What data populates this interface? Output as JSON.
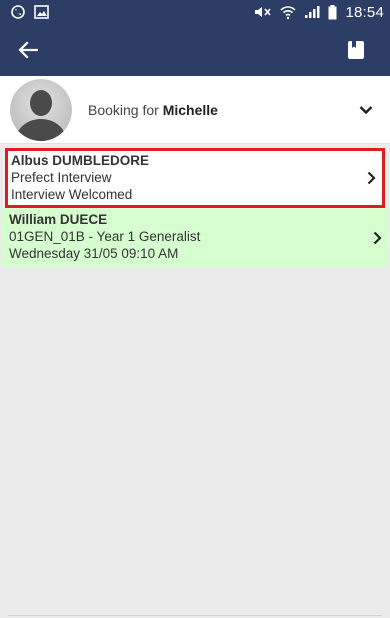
{
  "status_bar": {
    "time": "18:54",
    "icons": [
      "whatsapp-icon",
      "gallery-icon",
      "mute-icon",
      "wifi-icon",
      "signal-icon",
      "battery-icon"
    ]
  },
  "app_bar": {
    "back_icon": "arrow-left-icon",
    "book_icon": "book-icon",
    "background": "#2c3e66"
  },
  "booking": {
    "prefix": "Booking for ",
    "name": "Michelle"
  },
  "appointments": [
    {
      "name": "Albus DUMBLEDORE",
      "line2": "Prefect Interview",
      "line3": "Interview Welcomed",
      "style": "selected"
    },
    {
      "name": "William DUECE",
      "line2": "01GEN_01B - Year 1 Generalist",
      "line3": "Wednesday 31/05 09:10 AM",
      "style": "green"
    }
  ],
  "colors": {
    "selected_border": "#e01b24",
    "green_row": "#d6ffcf",
    "background": "#ececec"
  }
}
